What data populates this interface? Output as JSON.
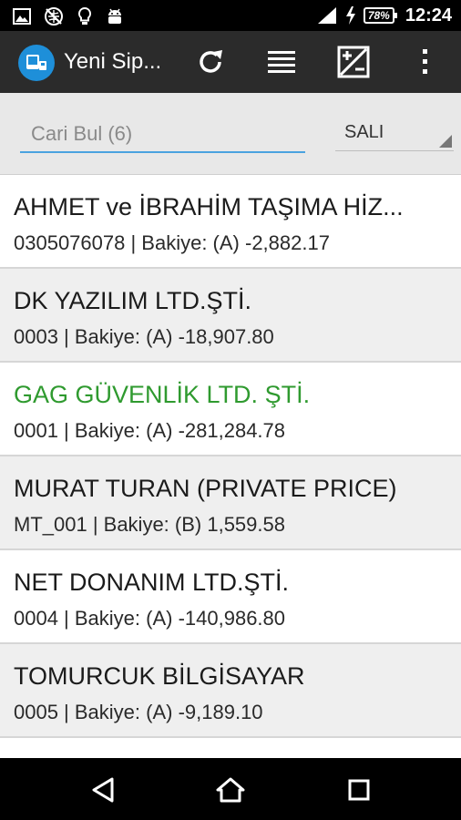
{
  "status_bar": {
    "time": "12:24",
    "battery": "78%",
    "icons": [
      "image-icon",
      "no-location-icon",
      "bulb-icon",
      "android-icon",
      "signal-icon",
      "charging-icon"
    ]
  },
  "action_bar": {
    "title": "Yeni Sip...",
    "icons": [
      "app-logo-icon",
      "refresh-icon",
      "list-icon",
      "plus-minus-icon",
      "overflow-menu-icon"
    ]
  },
  "search": {
    "placeholder": "Cari Bul (6)",
    "value": ""
  },
  "day_select": {
    "selected": "SALI"
  },
  "customers": [
    {
      "name": "AHMET ve İBRAHİM TAŞIMA HİZ...",
      "detail": "0305076078 | Bakiye: (A) -2,882.17",
      "highlight": false
    },
    {
      "name": "DK YAZILIM LTD.ŞTİ.",
      "detail": "0003 | Bakiye: (A) -18,907.80",
      "highlight": false
    },
    {
      "name": "GAG GÜVENLİK LTD. ŞTİ.",
      "detail": "0001 | Bakiye: (A) -281,284.78",
      "highlight": true
    },
    {
      "name": "MURAT TURAN (PRIVATE PRICE)",
      "detail": "MT_001 | Bakiye: (B) 1,559.58",
      "highlight": false
    },
    {
      "name": "NET DONANIM LTD.ŞTİ.",
      "detail": "0004 | Bakiye: (A) -140,986.80",
      "highlight": false
    },
    {
      "name": "TOMURCUK BİLGİSAYAR",
      "detail": "0005 | Bakiye: (A) -9,189.10",
      "highlight": false
    }
  ],
  "colors": {
    "highlight": "#2f9a2f",
    "action_bar": "#2b2b2b",
    "accent": "#4aa3df"
  },
  "nav_bar": {
    "icons": [
      "back-icon",
      "home-icon",
      "recents-icon"
    ]
  }
}
